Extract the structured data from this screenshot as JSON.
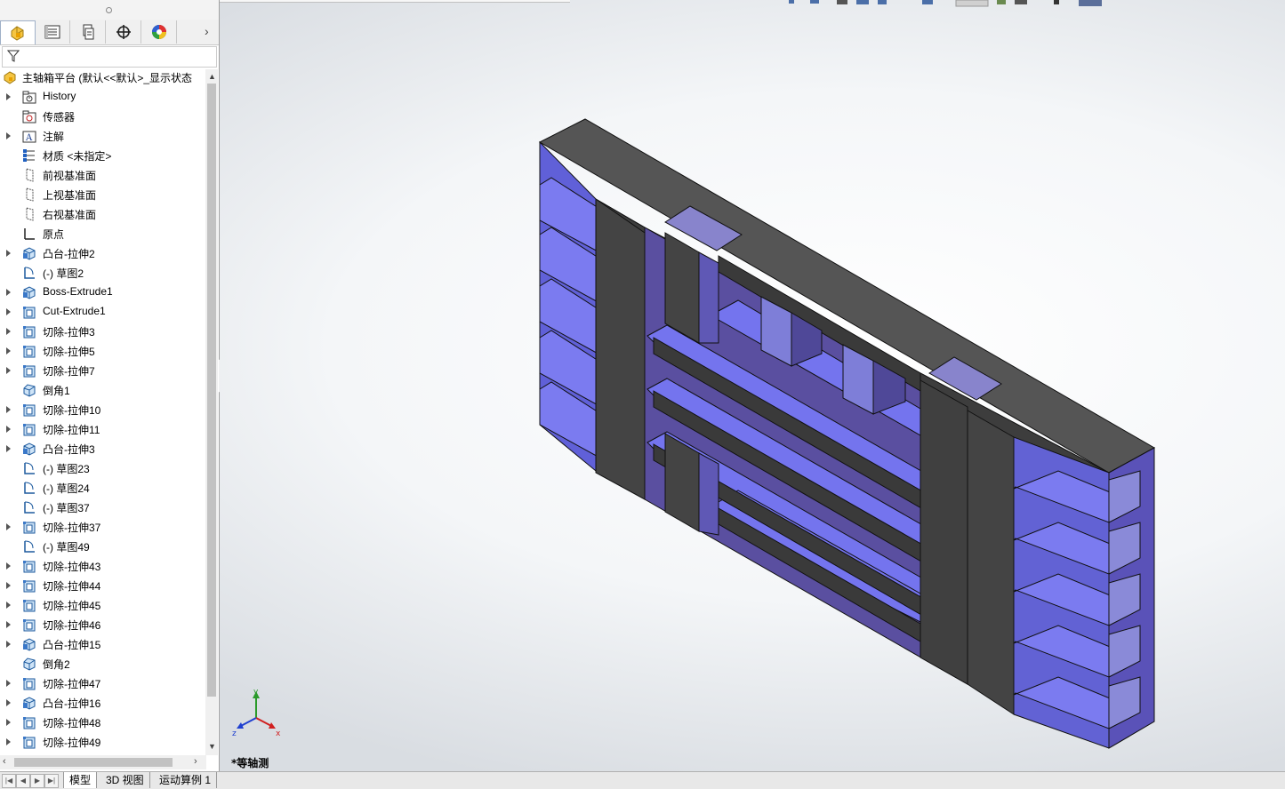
{
  "panel": {
    "tabs": [
      {
        "name": "featuremanager-tab",
        "icon": "featuremanager-icon"
      },
      {
        "name": "propertymanager-tab",
        "icon": "propertymanager-icon"
      },
      {
        "name": "configurationmanager-tab",
        "icon": "configurationmanager-icon"
      },
      {
        "name": "dimxpertmanager-tab",
        "icon": "dimxpert-icon"
      },
      {
        "name": "displaymanager-tab",
        "icon": "displaymanager-icon"
      }
    ],
    "more": "›",
    "root": "主轴箱平台 (默认<<默认>_显示状态",
    "items": [
      {
        "label": "History",
        "icon": "history-folder-icon",
        "expandable": true
      },
      {
        "label": "传感器",
        "icon": "sensor-folder-icon",
        "expandable": false
      },
      {
        "label": "注解",
        "icon": "annotation-folder-icon",
        "expandable": true
      },
      {
        "label": "材质 <未指定>",
        "icon": "material-icon",
        "expandable": false
      },
      {
        "label": "前视基准面",
        "icon": "plane-icon",
        "expandable": false
      },
      {
        "label": "上视基准面",
        "icon": "plane-icon",
        "expandable": false
      },
      {
        "label": "右视基准面",
        "icon": "plane-icon",
        "expandable": false
      },
      {
        "label": "原点",
        "icon": "origin-icon",
        "expandable": false
      },
      {
        "label": "凸台-拉伸2",
        "icon": "boss-extrude-icon",
        "expandable": true
      },
      {
        "label": "(-) 草图2",
        "icon": "sketch-icon",
        "expandable": false
      },
      {
        "label": "Boss-Extrude1",
        "icon": "boss-extrude-icon",
        "expandable": true
      },
      {
        "label": "Cut-Extrude1",
        "icon": "cut-extrude-icon",
        "expandable": true
      },
      {
        "label": "切除-拉伸3",
        "icon": "cut-extrude-icon",
        "expandable": true
      },
      {
        "label": "切除-拉伸5",
        "icon": "cut-extrude-icon",
        "expandable": true
      },
      {
        "label": "切除-拉伸7",
        "icon": "cut-extrude-icon",
        "expandable": true
      },
      {
        "label": "倒角1",
        "icon": "chamfer-icon",
        "expandable": false
      },
      {
        "label": "切除-拉伸10",
        "icon": "cut-extrude-icon",
        "expandable": true
      },
      {
        "label": "切除-拉伸11",
        "icon": "cut-extrude-icon",
        "expandable": true
      },
      {
        "label": "凸台-拉伸3",
        "icon": "boss-extrude-icon",
        "expandable": true
      },
      {
        "label": "(-) 草图23",
        "icon": "sketch-icon",
        "expandable": false
      },
      {
        "label": "(-) 草图24",
        "icon": "sketch-icon",
        "expandable": false
      },
      {
        "label": "(-) 草图37",
        "icon": "sketch-icon",
        "expandable": false
      },
      {
        "label": "切除-拉伸37",
        "icon": "cut-extrude-icon",
        "expandable": true
      },
      {
        "label": "(-) 草图49",
        "icon": "sketch-icon",
        "expandable": false
      },
      {
        "label": "切除-拉伸43",
        "icon": "cut-extrude-icon",
        "expandable": true
      },
      {
        "label": "切除-拉伸44",
        "icon": "cut-extrude-icon",
        "expandable": true
      },
      {
        "label": "切除-拉伸45",
        "icon": "cut-extrude-icon",
        "expandable": true
      },
      {
        "label": "切除-拉伸46",
        "icon": "cut-extrude-icon",
        "expandable": true
      },
      {
        "label": "凸台-拉伸15",
        "icon": "boss-extrude-icon",
        "expandable": true
      },
      {
        "label": "倒角2",
        "icon": "chamfer-icon",
        "expandable": false
      },
      {
        "label": "切除-拉伸47",
        "icon": "cut-extrude-icon",
        "expandable": true
      },
      {
        "label": "凸台-拉伸16",
        "icon": "boss-extrude-icon",
        "expandable": true
      },
      {
        "label": "切除-拉伸48",
        "icon": "cut-extrude-icon",
        "expandable": true
      },
      {
        "label": "切除-拉伸49",
        "icon": "cut-extrude-icon",
        "expandable": true
      }
    ]
  },
  "viewport": {
    "view_name": "*等轴测",
    "triad": {
      "x": "x",
      "y": "y",
      "z": "z"
    }
  },
  "bottom_tabs": [
    "模型",
    "3D 视图",
    "运动算例 1"
  ],
  "colors": {
    "model_dark": "#4a4a4a",
    "model_purple": "#7070e8",
    "panel_border": "#a0a0a0"
  }
}
